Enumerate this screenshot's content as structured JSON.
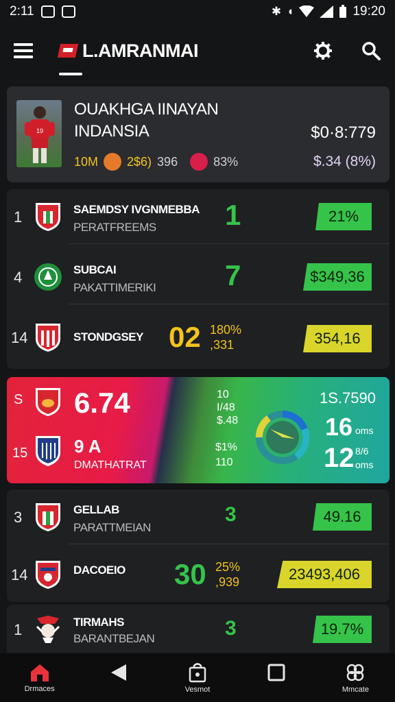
{
  "status_bar": {
    "time": "2:11",
    "clock": "19:20"
  },
  "app_bar": {
    "title": "L.AMRANMAI"
  },
  "featured": {
    "title_line1": "OUAKHGA IINAYAN",
    "title_line2": "INDANSIA",
    "price": "$0·8:779",
    "stat1": "10M",
    "stat2": "2$6)",
    "stat3": "396",
    "stat4": "83%",
    "change": "$.34 (8%)"
  },
  "rows_group1": [
    {
      "rank": "1",
      "name": "SAEMDSY IVGNMEBBA",
      "sub": "PERATFREEMS",
      "score": "1",
      "badge": "21%"
    },
    {
      "rank": "4",
      "name": "SUBCAI",
      "sub": "PAKATTIMERIKI",
      "score": "7",
      "badge": "$349,36"
    },
    {
      "rank": "14",
      "name": "STONDGSEY",
      "score": "02",
      "score_extra1": "180%",
      "score_extra2": ",331",
      "badge": "354,16"
    }
  ],
  "promo": {
    "rank1": "S",
    "rank2": "15",
    "value": "6.74",
    "sub_value": "9 A",
    "sub_label": "DMATHATRAT",
    "mid1": "10",
    "mid2": "I/48",
    "mid3": "$.48",
    "mid4": "$1%",
    "mid5": "110",
    "top_right": "1S.7590",
    "big1": "16",
    "unit1": "oms",
    "big2": "12",
    "unit2_top": "8/6",
    "unit2": "oms"
  },
  "rows_group2": [
    {
      "rank": "3",
      "name": "GELLAB",
      "sub": "PARATTMEIAN",
      "score": "3",
      "badge": "49.16"
    },
    {
      "rank": "14",
      "name": "DACOEIO",
      "score": "30",
      "score_extra1": "25%",
      "score_extra2": ",939",
      "badge": "23493,406"
    }
  ],
  "rows_group3": [
    {
      "rank": "1",
      "name": "TIRMAHS",
      "sub": "BARANTBEJAN",
      "score": "3",
      "badge": "19.7%"
    }
  ],
  "bottom_nav": [
    {
      "label": "Drmaces",
      "icon": "home-icon"
    },
    {
      "label": "",
      "icon": "back-icon"
    },
    {
      "label": "Vesmot",
      "icon": "bag-icon"
    },
    {
      "label": "",
      "icon": "square-icon"
    },
    {
      "label": "Mmcate",
      "icon": "cluster-icon"
    }
  ],
  "colors": {
    "green": "#35c34a",
    "yellow": "#f3c31c",
    "red": "#d32027",
    "bg": "#141517"
  }
}
